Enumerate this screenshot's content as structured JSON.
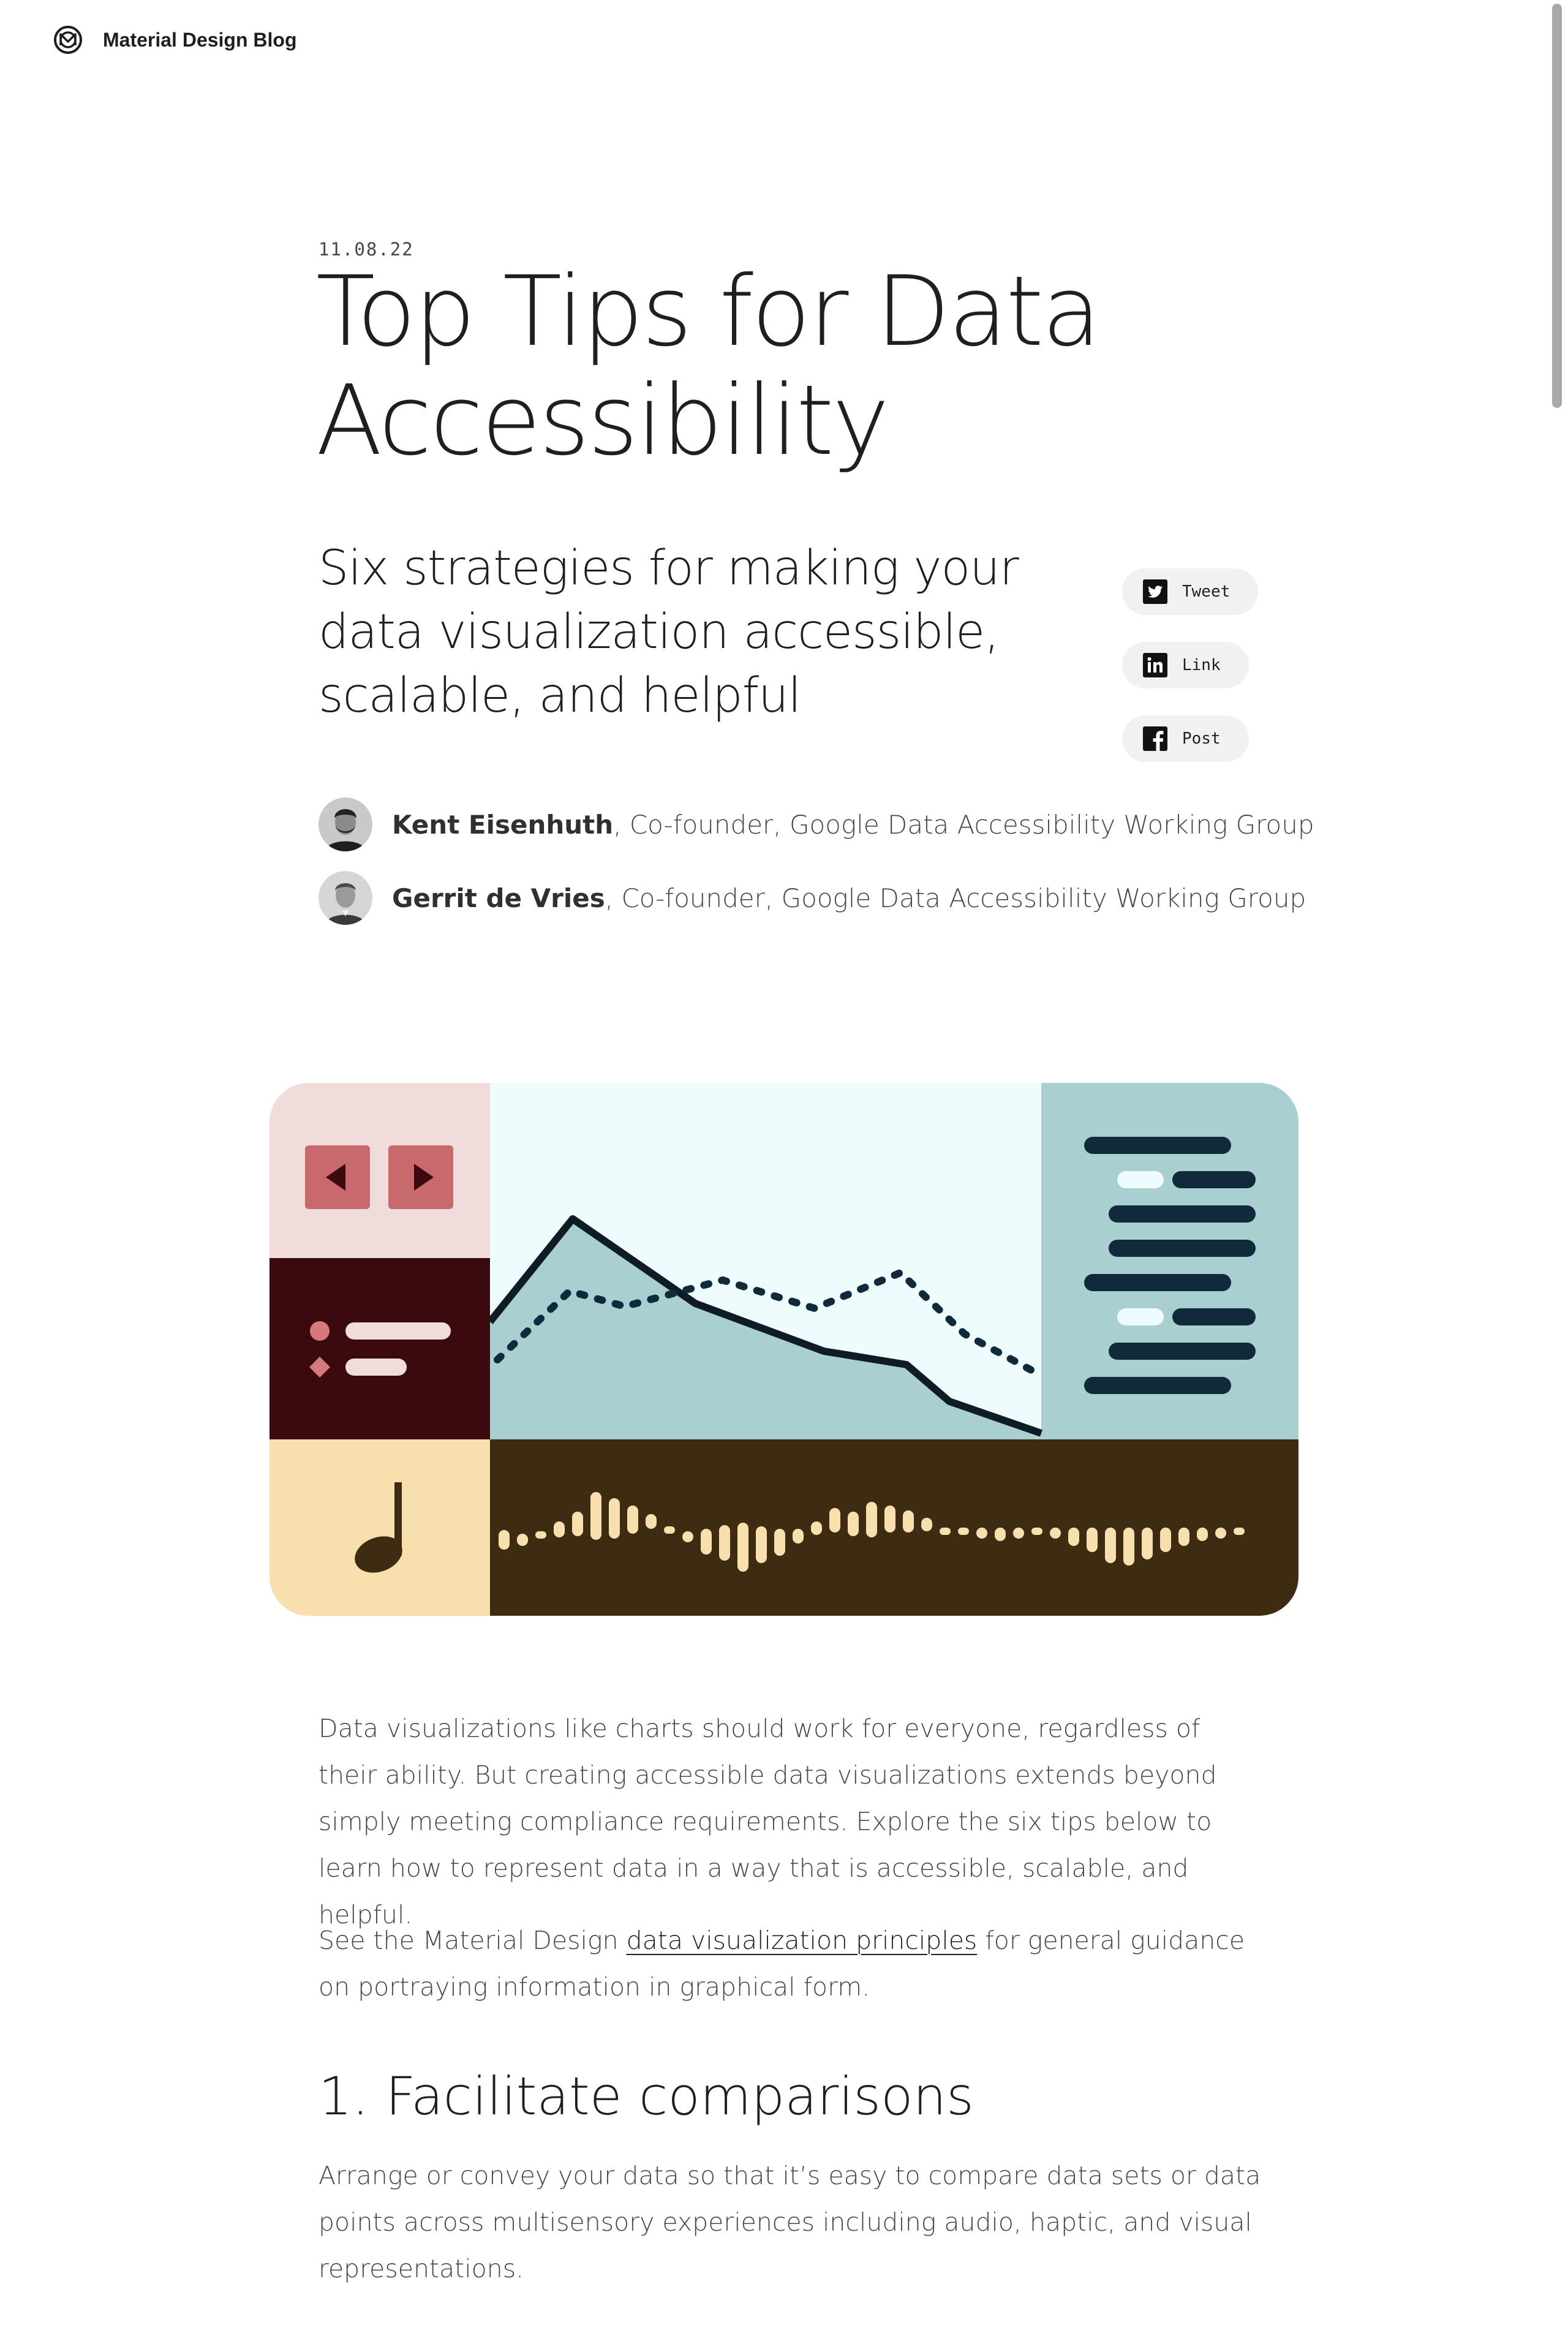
{
  "header": {
    "brand_name": "Material Design Blog",
    "logo_icon": "material-logo-icon"
  },
  "article": {
    "date": "11.08.22",
    "title_line1": "Top Tips for Data",
    "title_line2": "Accessibility",
    "subtitle_line1": "Six strategies for making your",
    "subtitle_line2": "data visualization accessible,",
    "subtitle_line3": "scalable, and helpful",
    "share": [
      {
        "label": "Tweet",
        "icon": "twitter-icon"
      },
      {
        "label": "Link",
        "icon": "linkedin-icon"
      },
      {
        "label": "Post",
        "icon": "facebook-icon"
      }
    ],
    "authors": [
      {
        "name": "Kent Eisenhuth",
        "role": ", Co-founder, Google Data Accessibility Working Group"
      },
      {
        "name": "Gerrit de Vries",
        "role": ", Co-founder, Google Data Accessibility Working Group"
      }
    ],
    "intro": "Data visualizations like charts should work for everyone, regardless of their ability. But creating accessible data visualizations extends beyond simply meeting compliance requirements. Explore the six tips below to learn how to represent data in a way that is accessible, scalable, and helpful.",
    "guidance_before": "See the Material Design ",
    "guidance_link": "data visualization principles",
    "guidance_after": " for general guidance on portraying information in graphical form.",
    "section1_heading": "1. Facilitate comparisons",
    "section1_body": "Arrange or convey your data so that it’s easy to compare data sets or data points across multisensory experiences including audio, haptic, and visual representations."
  },
  "colors": {
    "text": "#1f1f1f",
    "muted": "#444746",
    "share_bg": "#f1f1f1",
    "hero_pink": "#f0dcdb",
    "hero_maroon": "#3b0a0e",
    "hero_cream": "#f8dfae",
    "hero_sky": "#effcfd",
    "hero_teal": "#aacfd1",
    "hero_brown": "#3e2c12",
    "hero_navy": "#102a3b"
  }
}
